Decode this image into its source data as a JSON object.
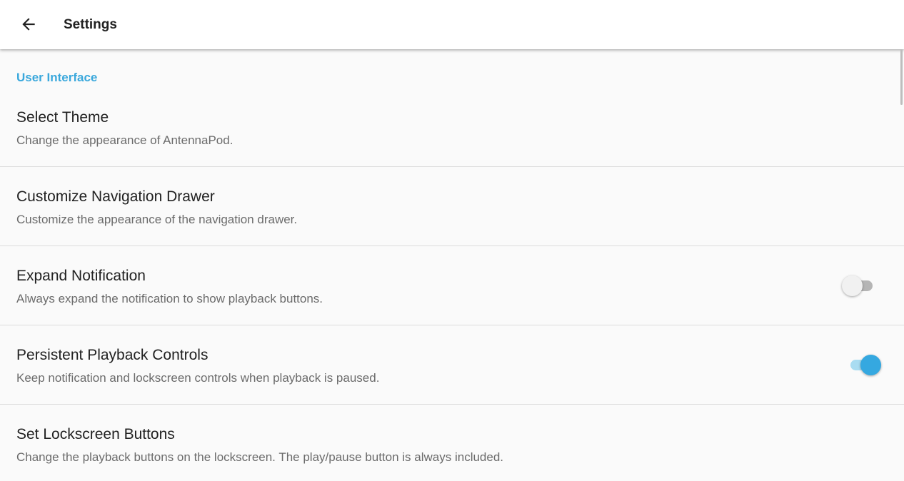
{
  "appbar": {
    "title": "Settings",
    "back_icon": "arrow-back-icon"
  },
  "category": {
    "label": "User Interface",
    "color": "#3aa8dc"
  },
  "preferences": [
    {
      "title": "Select Theme",
      "summary": "Change the appearance of AntennaPod."
    },
    {
      "title": "Customize Navigation Drawer",
      "summary": "Customize the appearance of the navigation drawer."
    },
    {
      "title": "Expand Notification",
      "summary": "Always expand the notification to show playback buttons.",
      "switch_on": false
    },
    {
      "title": "Persistent Playback Controls",
      "summary": "Keep notification and lockscreen controls when playback is paused.",
      "switch_on": true
    },
    {
      "title": "Set Lockscreen Buttons",
      "summary": "Change the playback buttons on the lockscreen. The play/pause button is always included."
    }
  ],
  "colors": {
    "accent": "#35a8e0",
    "background": "#fafafa",
    "appbar": "#ffffff"
  }
}
